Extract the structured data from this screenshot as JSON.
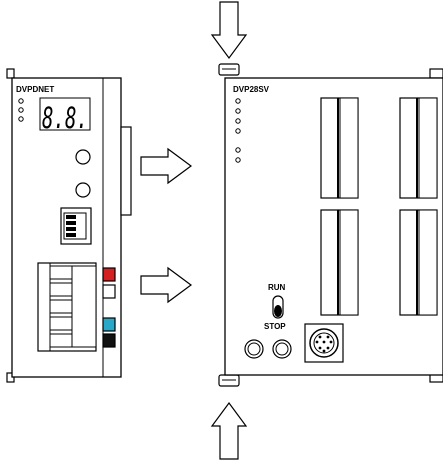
{
  "left_module": {
    "name": "DVPDNET",
    "display_text": "8.8.",
    "indicator_colors": [
      "#d42020",
      "#ffffff",
      "#2aa8c8",
      "#111111"
    ]
  },
  "right_module": {
    "name": "DVP28SV",
    "switch_top_label": "RUN",
    "switch_bottom_label": "STOP"
  },
  "arrows": {
    "count_horizontal": 2,
    "count_vertical": 2
  }
}
